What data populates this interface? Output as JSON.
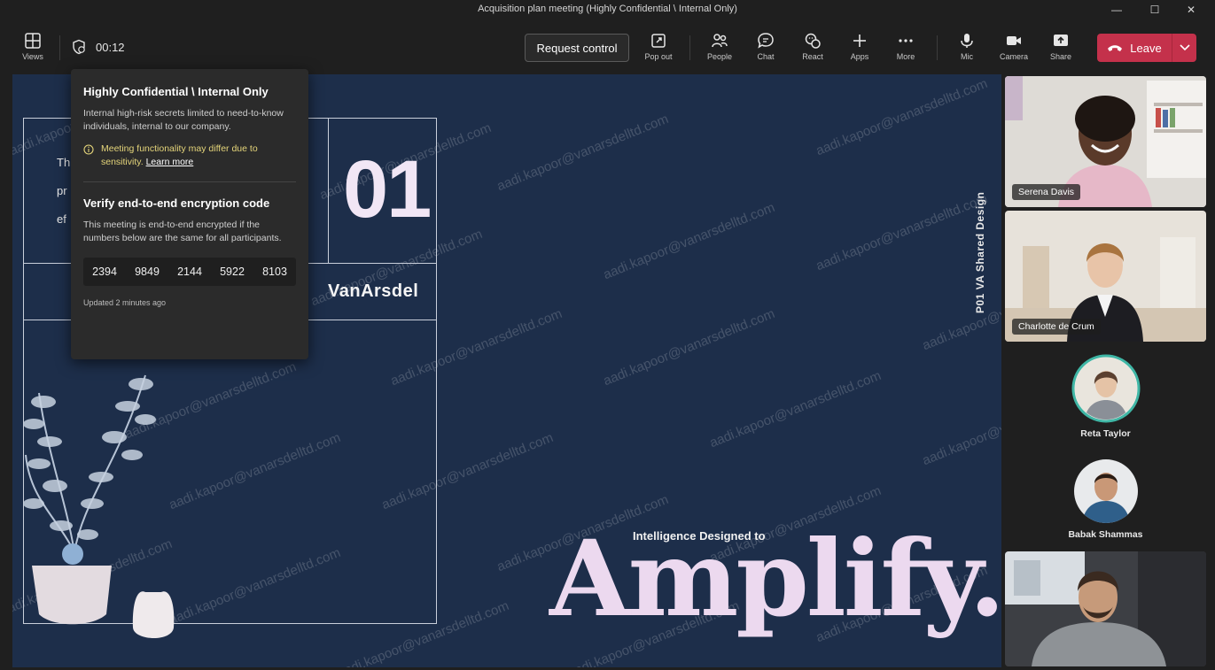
{
  "window": {
    "title": "Acquisition plan meeting (Highly Confidential \\ Internal Only)"
  },
  "toolbar": {
    "views_label": "Views",
    "timer": "00:12",
    "request_control_label": "Request control",
    "popout_label": "Pop out",
    "people_label": "People",
    "chat_label": "Chat",
    "react_label": "React",
    "apps_label": "Apps",
    "more_label": "More",
    "mic_label": "Mic",
    "camera_label": "Camera",
    "share_label": "Share",
    "leave_label": "Leave"
  },
  "popup": {
    "title": "Highly Confidential \\ Internal Only",
    "description": "Internal high-risk secrets limited to need-to-know individuals, internal to our company.",
    "warning": "Meeting functionality may differ due to sensitivity.",
    "learn_more": "Learn more",
    "verify_title": "Verify end-to-end encryption code",
    "verify_description": "This meeting is end-to-end encrypted if the numbers below are the same for all participants.",
    "codes": [
      "2394",
      "9849",
      "2144",
      "5922",
      "8103"
    ],
    "updated": "Updated 2 minutes ago"
  },
  "slide": {
    "number": "01",
    "brand": "VanArsdel",
    "vertical_text": "P01   VA Shared Design",
    "tagline": "Intelligence Designed to",
    "headline": "Amplify.",
    "fragments": [
      "Th",
      "pr",
      "ef"
    ],
    "watermark": "aadi.kapoor@vanarsdelltd.com"
  },
  "participants": [
    {
      "name": "Serena Davis",
      "kind": "video"
    },
    {
      "name": "Charlotte de Crum",
      "kind": "video"
    },
    {
      "name": "Reta Taylor",
      "kind": "avatar"
    },
    {
      "name": "Babak Shammas",
      "kind": "avatar"
    },
    {
      "name": "",
      "kind": "video"
    }
  ],
  "colors": {
    "leave": "#c4314b",
    "slide_bg": "#1d2e4a",
    "headline": "#ecd9ef",
    "warning": "#e5d57a"
  }
}
